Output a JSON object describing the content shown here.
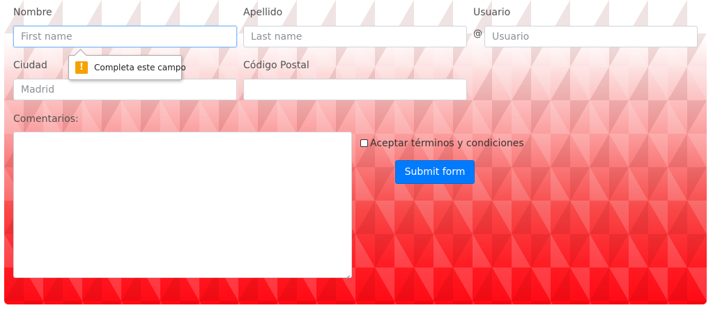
{
  "form": {
    "nombre_label": "Nombre",
    "apellido_label": "Apellido",
    "usuario_label": "Usuario",
    "first_name_placeholder": "First name",
    "last_name_placeholder": "Last name",
    "at_symbol": "@",
    "usuario_placeholder": "Usuario",
    "ciudad_label": "Ciudad",
    "ciudad_placeholder": "Madrid",
    "codigo_postal_label": "Código Postal",
    "codigo_postal_value": "",
    "comentarios_label": "Comentarios:",
    "comentarios_value": "",
    "terms_label": "Aceptar términos y condiciones",
    "terms_checked": false,
    "submit_label": "Submit form"
  },
  "validation_tooltip": {
    "icon": "warning-icon",
    "icon_glyph": "!",
    "message": "Completa este campo"
  },
  "colors": {
    "button": "#007bff",
    "warning": "#f5a100",
    "background_bottom": "#ff0a14"
  }
}
